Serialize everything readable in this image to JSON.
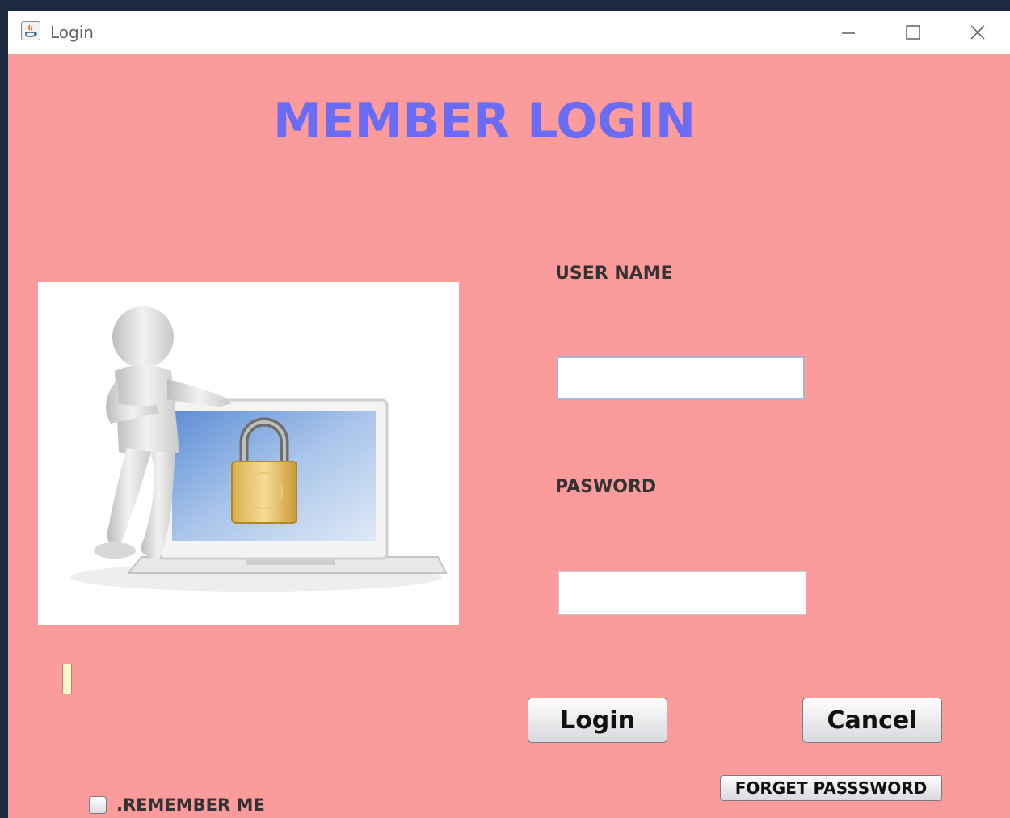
{
  "window": {
    "title": "Login"
  },
  "header": {
    "title": "MEMBER LOGIN"
  },
  "form": {
    "username_label": "USER NAME",
    "username_value": "",
    "password_label": "PASWORD",
    "password_value": "",
    "login_label": "Login",
    "cancel_label": "Cancel",
    "forget_label": "FORGET PASSSWORD",
    "remember_label": ".REMEMBER ME",
    "remember_checked": false
  },
  "illustration": {
    "icon": "user-with-locked-laptop-icon"
  },
  "colors": {
    "background": "#fc9b9b",
    "title": "#6b6cf5"
  }
}
